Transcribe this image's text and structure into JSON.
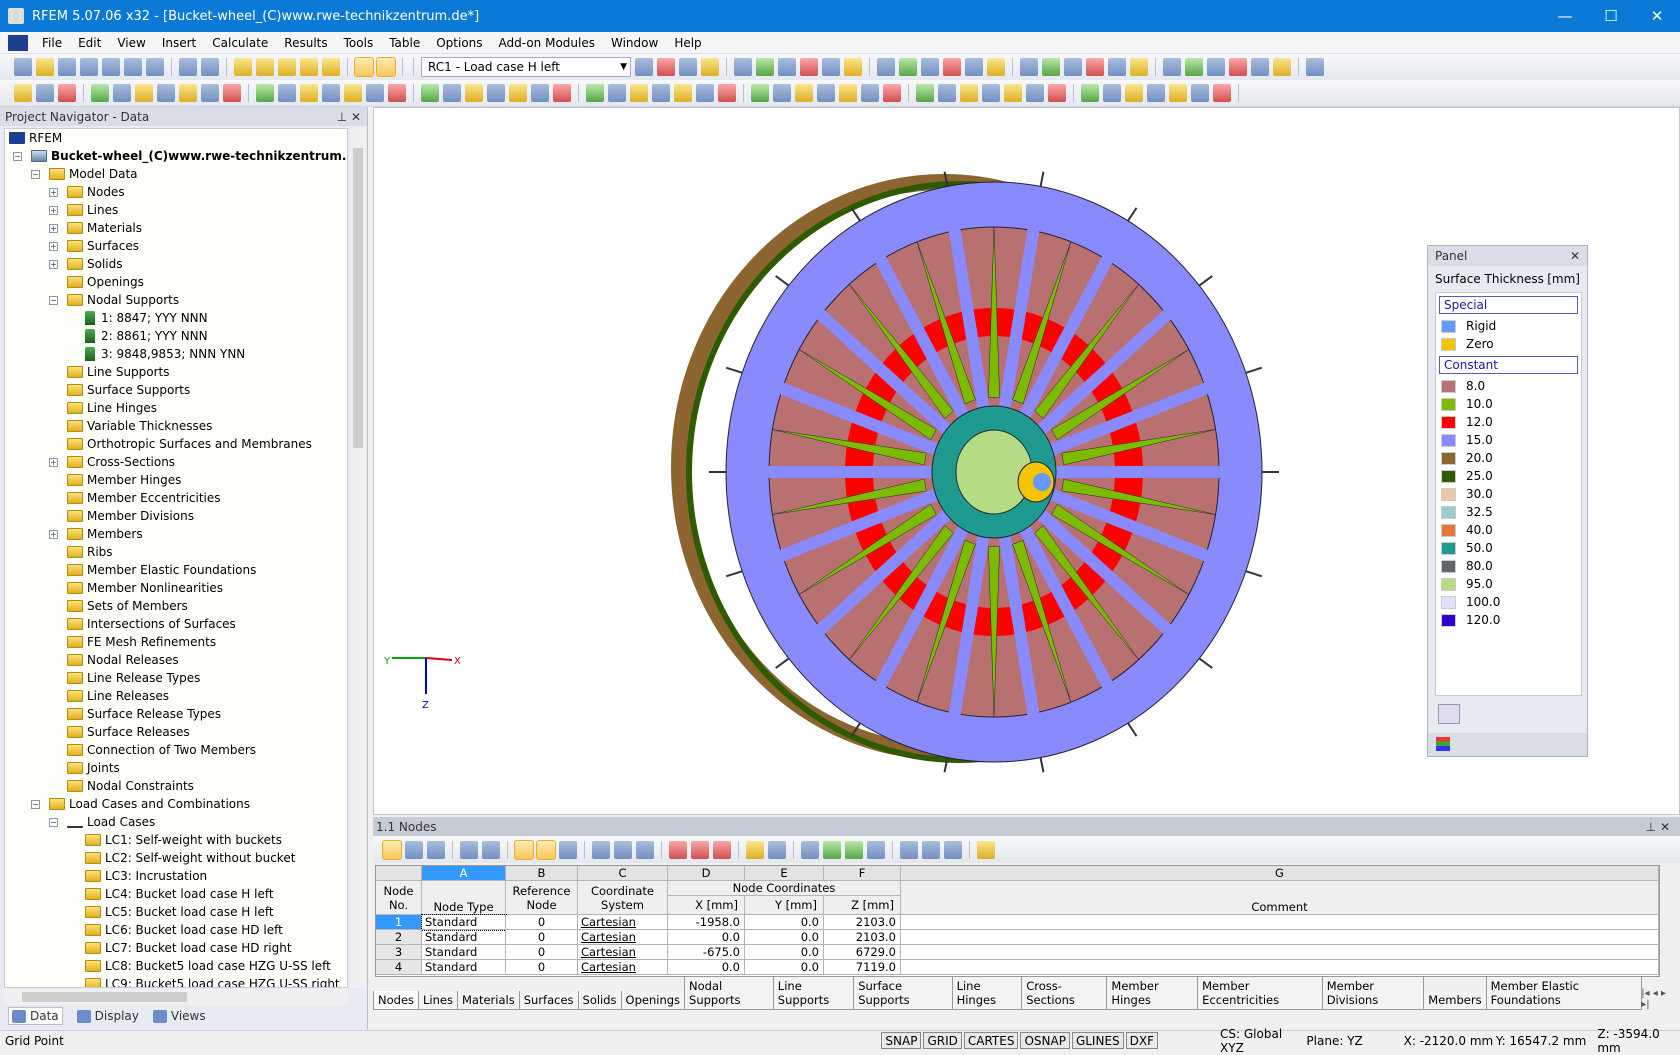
{
  "window": {
    "title": "RFEM 5.07.06 x32 - [Bucket-wheel_(C)www.rwe-technikzentrum.de*]",
    "minimize": "—",
    "maximize": "☐",
    "close": "✕"
  },
  "menu": [
    "File",
    "Edit",
    "View",
    "Insert",
    "Calculate",
    "Results",
    "Tools",
    "Table",
    "Options",
    "Add-on Modules",
    "Window",
    "Help"
  ],
  "toolbar": {
    "load_case": "RC1 - Load case H left"
  },
  "navigator": {
    "title": "Project Navigator - Data",
    "tree": [
      {
        "label": "RFEM",
        "level": 0,
        "icon": "rfem-logo-icon"
      },
      {
        "label": "Bucket-wheel_(C)www.rwe-technikzentrum.de*",
        "level": 1,
        "icon": "model-file-icon",
        "bold": true,
        "expander": "−"
      },
      {
        "label": "Model Data",
        "level": 2,
        "icon": "folder-icon",
        "expander": "−"
      },
      {
        "label": "Nodes",
        "level": 3,
        "icon": "folder-icon",
        "expander": "+"
      },
      {
        "label": "Lines",
        "level": 3,
        "icon": "folder-icon",
        "expander": "+"
      },
      {
        "label": "Materials",
        "level": 3,
        "icon": "folder-icon",
        "expander": "+"
      },
      {
        "label": "Surfaces",
        "level": 3,
        "icon": "folder-icon",
        "expander": "+"
      },
      {
        "label": "Solids",
        "level": 3,
        "icon": "folder-icon",
        "expander": "+"
      },
      {
        "label": "Openings",
        "level": 3,
        "icon": "folder-icon"
      },
      {
        "label": "Nodal Supports",
        "level": 3,
        "icon": "folder-icon",
        "expander": "−"
      },
      {
        "label": "1: 8847; YYY NNN",
        "level": 4,
        "icon": "support-icon"
      },
      {
        "label": "2: 8861; YYY NNN",
        "level": 4,
        "icon": "support-icon"
      },
      {
        "label": "3: 9848,9853; NNN YNN",
        "level": 4,
        "icon": "support-icon"
      },
      {
        "label": "Line Supports",
        "level": 3,
        "icon": "folder-icon"
      },
      {
        "label": "Surface Supports",
        "level": 3,
        "icon": "folder-icon"
      },
      {
        "label": "Line Hinges",
        "level": 3,
        "icon": "folder-icon"
      },
      {
        "label": "Variable Thicknesses",
        "level": 3,
        "icon": "folder-icon"
      },
      {
        "label": "Orthotropic Surfaces and Membranes",
        "level": 3,
        "icon": "folder-icon"
      },
      {
        "label": "Cross-Sections",
        "level": 3,
        "icon": "folder-icon",
        "expander": "+"
      },
      {
        "label": "Member Hinges",
        "level": 3,
        "icon": "folder-icon"
      },
      {
        "label": "Member Eccentricities",
        "level": 3,
        "icon": "folder-icon"
      },
      {
        "label": "Member Divisions",
        "level": 3,
        "icon": "folder-icon"
      },
      {
        "label": "Members",
        "level": 3,
        "icon": "folder-icon",
        "expander": "+"
      },
      {
        "label": "Ribs",
        "level": 3,
        "icon": "folder-icon"
      },
      {
        "label": "Member Elastic Foundations",
        "level": 3,
        "icon": "folder-icon"
      },
      {
        "label": "Member Nonlinearities",
        "level": 3,
        "icon": "folder-icon"
      },
      {
        "label": "Sets of Members",
        "level": 3,
        "icon": "folder-icon"
      },
      {
        "label": "Intersections of Surfaces",
        "level": 3,
        "icon": "folder-icon"
      },
      {
        "label": "FE Mesh Refinements",
        "level": 3,
        "icon": "folder-icon"
      },
      {
        "label": "Nodal Releases",
        "level": 3,
        "icon": "folder-icon"
      },
      {
        "label": "Line Release Types",
        "level": 3,
        "icon": "folder-icon"
      },
      {
        "label": "Line Releases",
        "level": 3,
        "icon": "folder-icon"
      },
      {
        "label": "Surface Release Types",
        "level": 3,
        "icon": "folder-icon"
      },
      {
        "label": "Surface Releases",
        "level": 3,
        "icon": "folder-icon"
      },
      {
        "label": "Connection of Two Members",
        "level": 3,
        "icon": "folder-icon"
      },
      {
        "label": "Joints",
        "level": 3,
        "icon": "folder-icon"
      },
      {
        "label": "Nodal Constraints",
        "level": 3,
        "icon": "folder-icon"
      },
      {
        "label": "Load Cases and Combinations",
        "level": 2,
        "icon": "folder-icon",
        "expander": "−"
      },
      {
        "label": "Load Cases",
        "level": 3,
        "icon": "load-case-icon",
        "expander": "−"
      },
      {
        "label": "LC1: Self-weight with buckets",
        "level": 4,
        "icon": "folder-icon"
      },
      {
        "label": "LC2: Self-weight without bucket",
        "level": 4,
        "icon": "folder-icon"
      },
      {
        "label": "LC3: Incrustation",
        "level": 4,
        "icon": "folder-icon"
      },
      {
        "label": "LC4: Bucket load case H left",
        "level": 4,
        "icon": "folder-icon"
      },
      {
        "label": "LC5: Bucket load case H left",
        "level": 4,
        "icon": "folder-icon"
      },
      {
        "label": "LC6: Bucket load case HD left",
        "level": 4,
        "icon": "folder-icon"
      },
      {
        "label": "LC7: Bucket load case HD right",
        "level": 4,
        "icon": "folder-icon"
      },
      {
        "label": "LC8: Bucket5 load case HZG U-SS left",
        "level": 4,
        "icon": "folder-icon"
      },
      {
        "label": "LC9: Bucket5 load case HZG U-SS right",
        "level": 4,
        "icon": "folder-icon"
      }
    ],
    "tabs": [
      "Data",
      "Display",
      "Views"
    ]
  },
  "panel": {
    "title": "Panel",
    "subtitle": "Surface Thickness",
    "unit": "[mm]",
    "groups": [
      {
        "header": "Special",
        "items": [
          {
            "label": "Rigid",
            "color": "#6699ff"
          },
          {
            "label": "Zero",
            "color": "#f5c400"
          }
        ]
      },
      {
        "header": "Constant",
        "items": [
          {
            "label": "8.0",
            "color": "#b87070"
          },
          {
            "label": "10.0",
            "color": "#7cbb00"
          },
          {
            "label": "12.0",
            "color": "#ff0000"
          },
          {
            "label": "15.0",
            "color": "#8a8aff"
          },
          {
            "label": "20.0",
            "color": "#8d6530"
          },
          {
            "label": "25.0",
            "color": "#2e5a00"
          },
          {
            "label": "30.0",
            "color": "#ecc7a3"
          },
          {
            "label": "32.5",
            "color": "#9ccccc"
          },
          {
            "label": "40.0",
            "color": "#e8763a"
          },
          {
            "label": "50.0",
            "color": "#1f9a8e"
          },
          {
            "label": "80.0",
            "color": "#60646c"
          },
          {
            "label": "95.0",
            "color": "#b5db85"
          },
          {
            "label": "100.0",
            "color": "#dfe0fa"
          },
          {
            "label": "120.0",
            "color": "#3300cc"
          }
        ]
      }
    ]
  },
  "axes": {
    "y": "Y",
    "x": "X",
    "z": "Z"
  },
  "table": {
    "title": "1.1 Nodes",
    "letters": [
      "A",
      "B",
      "C",
      "D",
      "E",
      "F",
      "G"
    ],
    "headers": {
      "node_no": "Node No.",
      "node_type": "Node Type",
      "ref_node": "Reference Node",
      "coord_sys": "Coordinate System",
      "node_coords": "Node Coordinates",
      "x": "X [mm]",
      "y": "Y [mm]",
      "z": "Z [mm]",
      "comment": "Comment"
    },
    "rows": [
      {
        "no": "1",
        "type": "Standard",
        "ref": "0",
        "cs": "Cartesian",
        "x": "-1958.0",
        "y": "0.0",
        "z": "2103.0",
        "comment": ""
      },
      {
        "no": "2",
        "type": "Standard",
        "ref": "0",
        "cs": "Cartesian",
        "x": "0.0",
        "y": "0.0",
        "z": "2103.0",
        "comment": ""
      },
      {
        "no": "3",
        "type": "Standard",
        "ref": "0",
        "cs": "Cartesian",
        "x": "-675.0",
        "y": "0.0",
        "z": "6729.0",
        "comment": ""
      },
      {
        "no": "4",
        "type": "Standard",
        "ref": "0",
        "cs": "Cartesian",
        "x": "0.0",
        "y": "0.0",
        "z": "7119.0",
        "comment": ""
      }
    ],
    "tabs": [
      "Nodes",
      "Lines",
      "Materials",
      "Surfaces",
      "Solids",
      "Openings",
      "Nodal Supports",
      "Line Supports",
      "Surface Supports",
      "Line Hinges",
      "Cross-Sections",
      "Member Hinges",
      "Member Eccentricities",
      "Member Divisions",
      "Members",
      "Member Elastic Foundations"
    ],
    "active_tab": "Nodes"
  },
  "status": {
    "left": "Grid Point",
    "toggles": [
      "SNAP",
      "GRID",
      "CARTES",
      "OSNAP",
      "GLINES",
      "DXF"
    ],
    "cs": "CS: Global XYZ",
    "plane": "Plane: YZ",
    "x": "X: -2120.0 mm",
    "y": "Y: 16547.2 mm",
    "z": "Z: -3594.0 mm"
  }
}
